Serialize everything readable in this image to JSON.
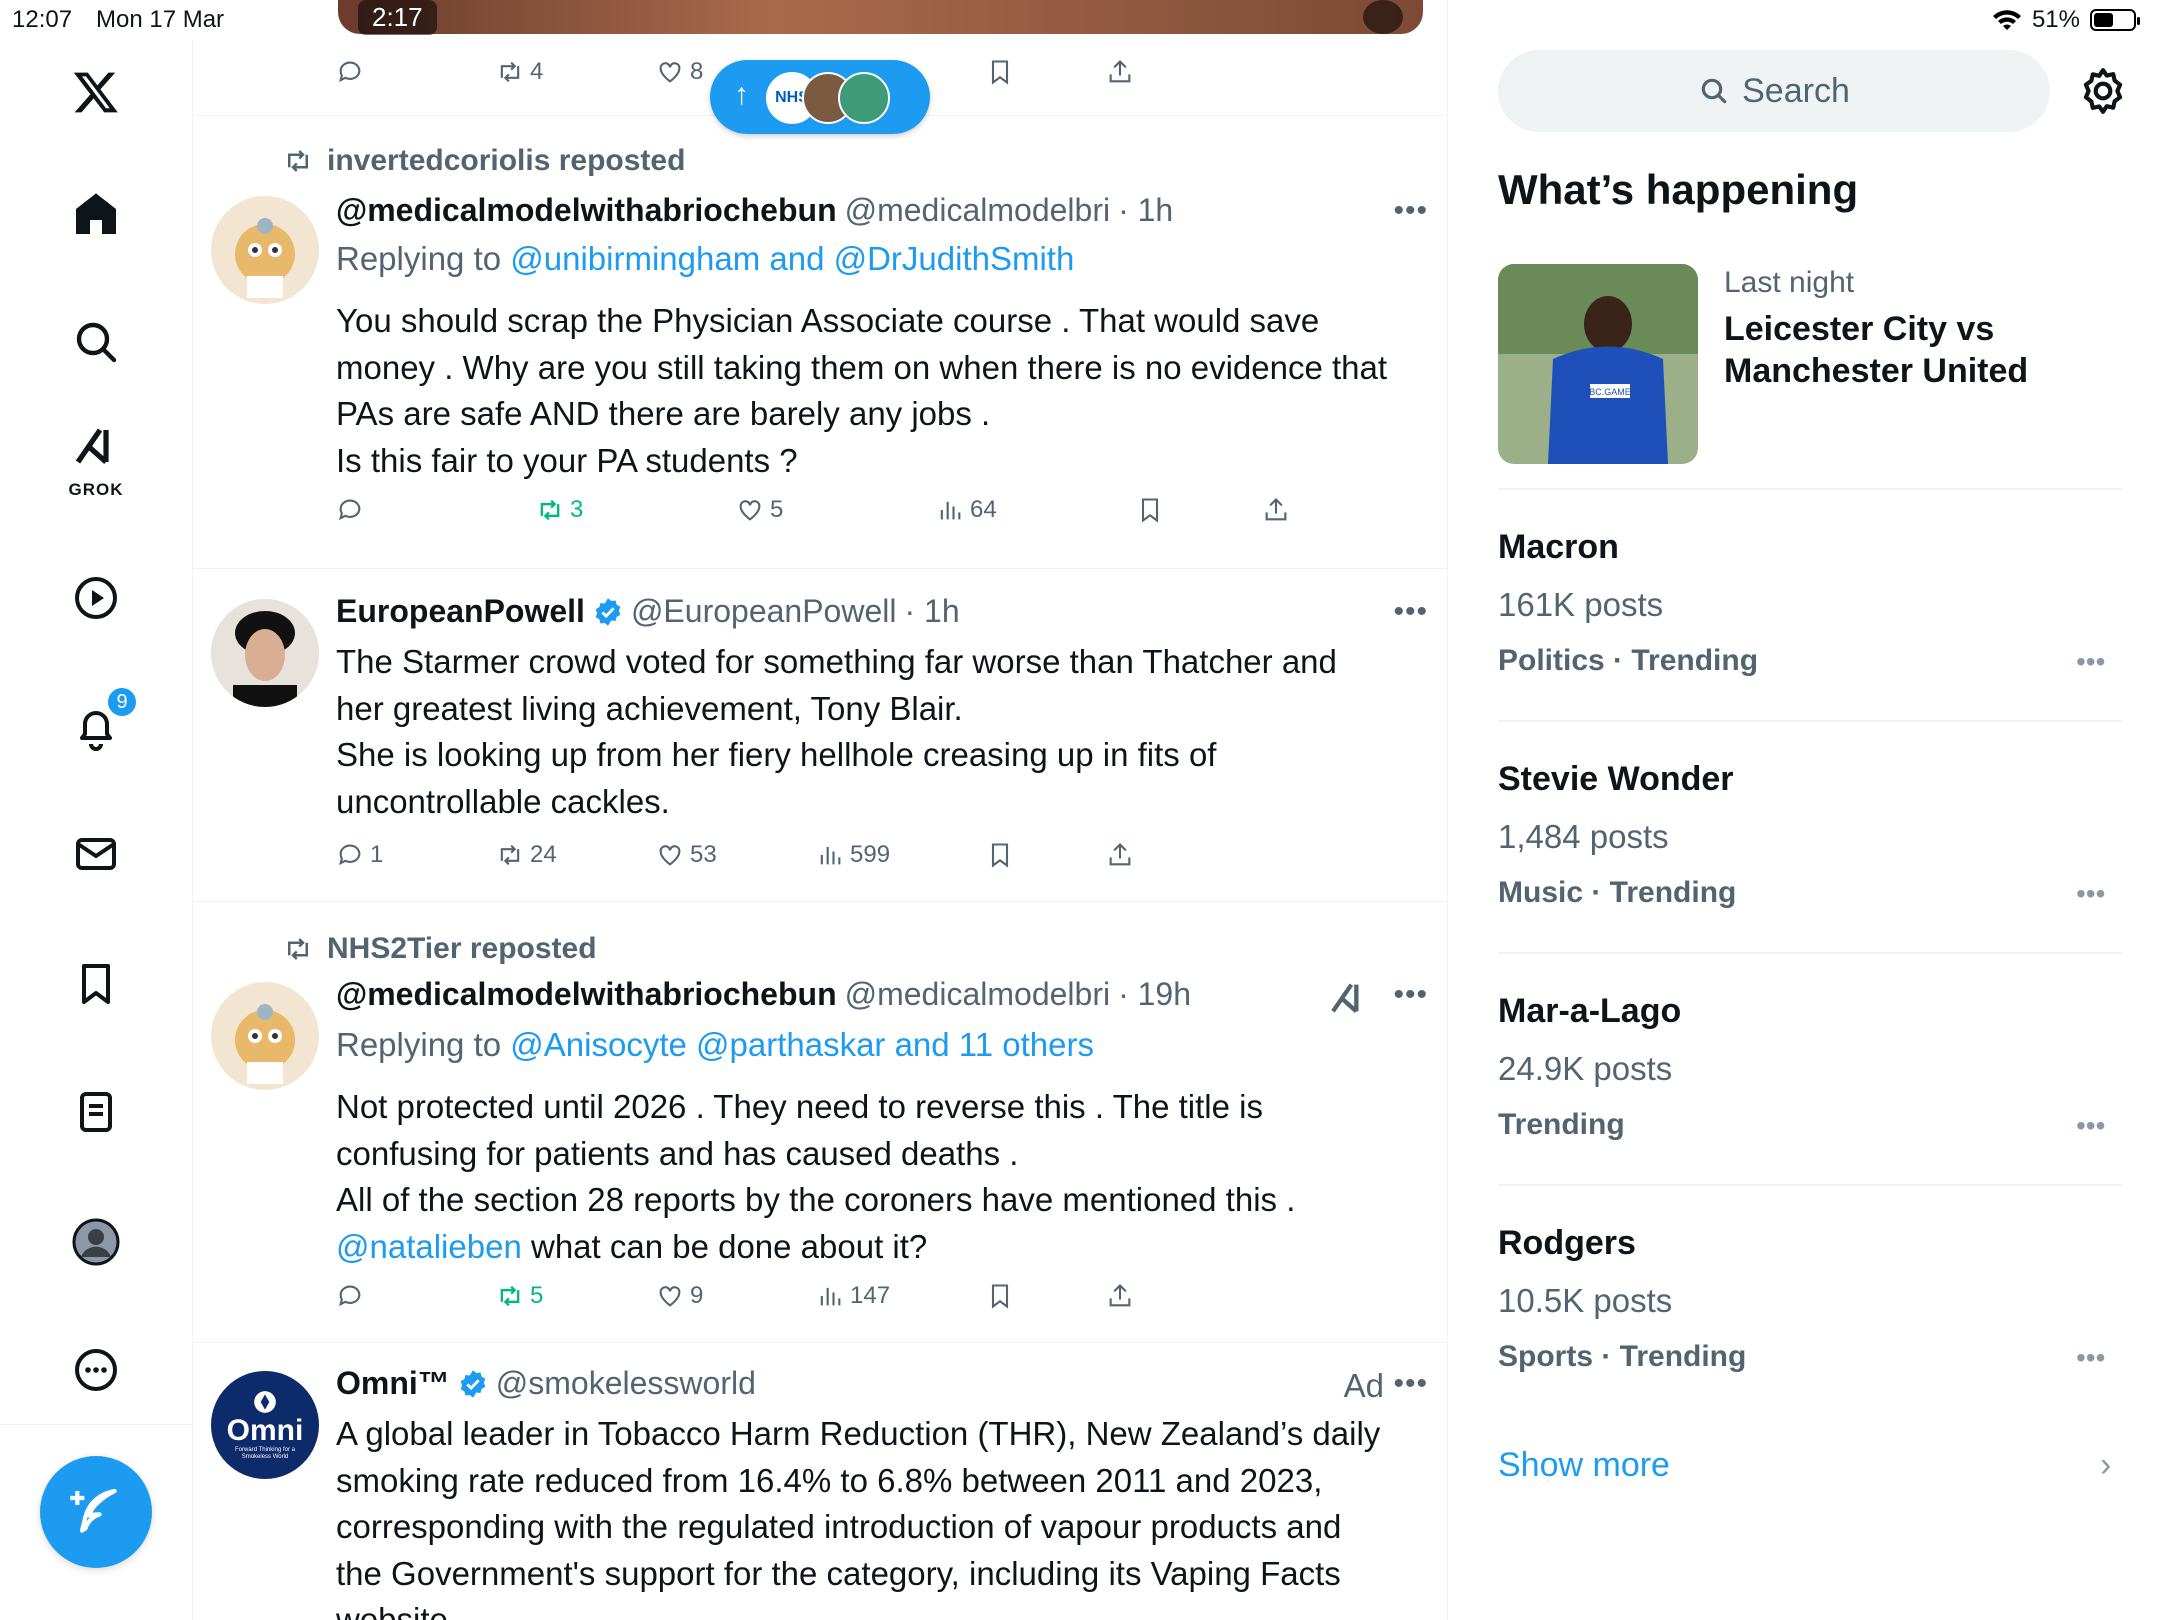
{
  "status_bar": {
    "time": "12:07",
    "date": "Mon 17 Mar",
    "battery": "51%",
    "battery_level": 0.51
  },
  "nav": {
    "items": [
      "x-logo",
      "home",
      "explore",
      "grok",
      "videos",
      "notifications",
      "messages",
      "bookmarks",
      "lists",
      "profile",
      "more"
    ],
    "grok_label": "GROK",
    "notifications_badge": "9"
  },
  "video": {
    "time": "2:17"
  },
  "tweets": [
    {
      "actions": {
        "replies": "",
        "reposts": "4",
        "likes": "8",
        "views": ""
      }
    },
    {
      "repost_by": "invertedcoriolis reposted",
      "name": "@medicalmodelwithabriochebun",
      "handle": "@medicalmodelbri",
      "time": "· 1h",
      "reply_prefix": "Replying to ",
      "reply_links": "@unibirmingham and @DrJudithSmith",
      "body_lines": [
        "You should scrap the Physician Associate course . That would save",
        "money . Why are you still taking them on when there is no evidence that",
        "PAs are safe AND there are barely any jobs .",
        "Is this fair to your PA students ?"
      ],
      "actions": {
        "replies": "",
        "reposts": "3",
        "likes": "5",
        "views": "64"
      }
    },
    {
      "name": "EuropeanPowell",
      "handle": "@EuropeanPowell",
      "time": "· 1h",
      "body_lines": [
        "The Starmer crowd voted for something far worse than Thatcher and",
        "her greatest living achievement, Tony Blair.",
        "She is looking up from her fiery hellhole creasing up in fits of",
        "uncontrollable cackles."
      ],
      "actions": {
        "replies": "1",
        "reposts": "24",
        "likes": "53",
        "views": "599"
      }
    },
    {
      "repost_by": "NHS2Tier reposted",
      "name": "@medicalmodelwithabriochebun",
      "handle": "@medicalmodelbri",
      "time": "· 19h",
      "reply_prefix": "Replying to ",
      "reply_links": "@Anisocyte @parthaskar and 11 others",
      "body_lines": [
        "Not protected until 2026 . They need to reverse this . The title is",
        "confusing for patients and has caused deaths .",
        "All of the section 28 reports by the coroners have  mentioned this ."
      ],
      "body_mention": "@natalieben",
      "body_tail": " what can be done about it?",
      "actions": {
        "replies": "",
        "reposts": "5",
        "likes": "9",
        "views": "147"
      }
    },
    {
      "name": "Omni™",
      "handle": "@smokelessworld",
      "ad": "Ad",
      "avatar_text": "Omni",
      "avatar_tagline": "Forward Thinking for a Smokeless World",
      "body_lines": [
        "A global leader in Tobacco Harm Reduction (THR), New Zealand’s daily",
        "smoking rate reduced from 16.4% to 6.8% between 2011 and 2023,",
        "corresponding with the regulated introduction of vapour products and",
        "the Government's support for the category, including its Vaping Facts",
        "website."
      ]
    }
  ],
  "new_posts": {
    "badge_text": "NHS"
  },
  "sidebar": {
    "search_placeholder": "Search",
    "whats_happening": "What’s happening",
    "top_trend": {
      "subtitle": "Last night",
      "title": "Leicester City vs Manchester United",
      "jersey_text": "BC.GAME"
    },
    "trends": [
      {
        "name": "Macron",
        "count": "161K posts",
        "category": "Politics · Trending"
      },
      {
        "name": "Stevie Wonder",
        "count": "1,484 posts",
        "category": "Music · Trending"
      },
      {
        "name": "Mar-a-Lago",
        "count": "24.9K posts",
        "category": "Trending"
      },
      {
        "name": "Rodgers",
        "count": "10.5K posts",
        "category": "Sports · Trending"
      }
    ],
    "show_more": "Show more"
  },
  "colors": {
    "accent": "#1d9bf0",
    "repost_green": "#00ba7c",
    "muted": "#536471"
  }
}
